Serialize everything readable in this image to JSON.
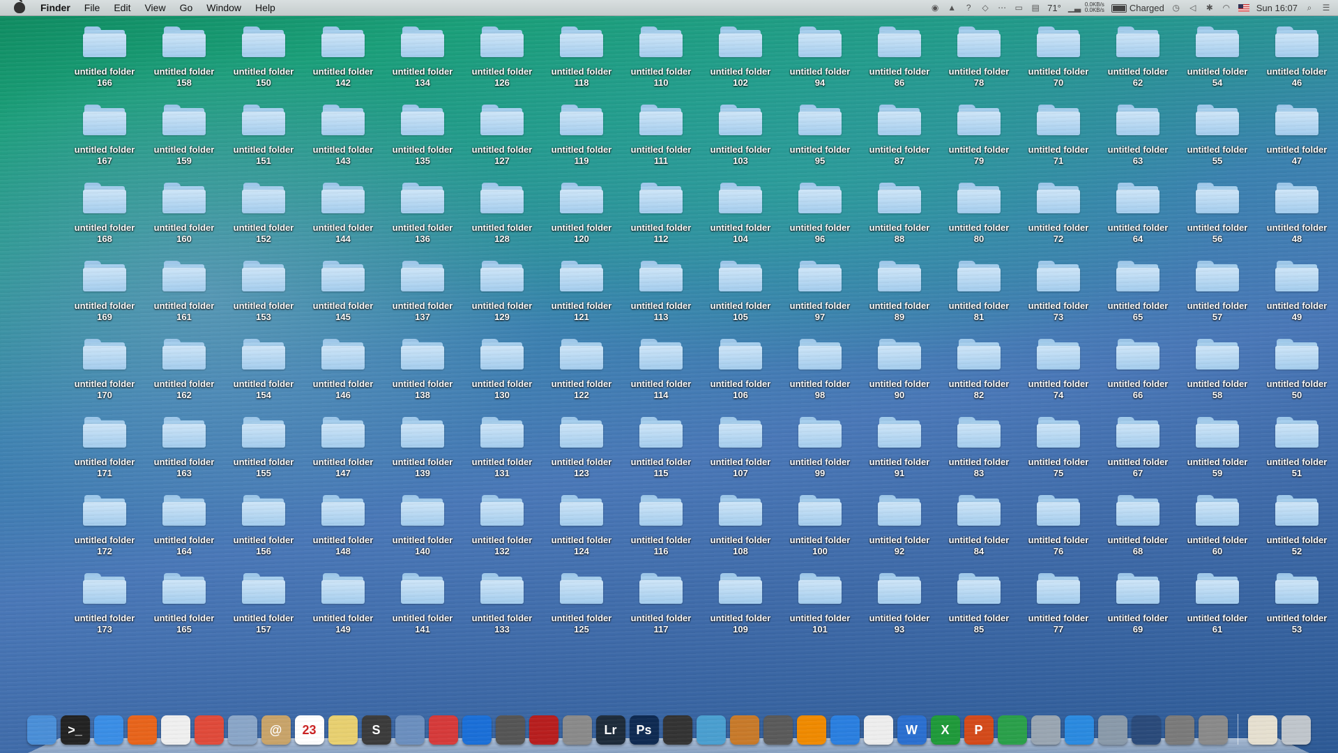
{
  "menubar": {
    "app_name": "Finder",
    "items": [
      "File",
      "Edit",
      "View",
      "Go",
      "Window",
      "Help"
    ],
    "temperature": "71°",
    "network_up": "0.0KB/s",
    "network_down": "0.0KB/s",
    "battery_status": "Charged",
    "clock": "Sun 16:07"
  },
  "folders_label": "untitled folder",
  "folder_numbers": [
    166,
    158,
    150,
    142,
    134,
    126,
    118,
    110,
    102,
    94,
    86,
    78,
    70,
    62,
    54,
    46,
    167,
    159,
    151,
    143,
    135,
    127,
    119,
    111,
    103,
    95,
    87,
    79,
    71,
    63,
    55,
    47,
    168,
    160,
    152,
    144,
    136,
    128,
    120,
    112,
    104,
    96,
    88,
    80,
    72,
    64,
    56,
    48,
    169,
    161,
    153,
    145,
    137,
    129,
    121,
    113,
    105,
    97,
    89,
    81,
    73,
    65,
    57,
    49,
    170,
    162,
    154,
    146,
    138,
    130,
    122,
    114,
    106,
    98,
    90,
    82,
    74,
    66,
    58,
    50,
    171,
    163,
    155,
    147,
    139,
    131,
    123,
    115,
    107,
    99,
    91,
    83,
    75,
    67,
    59,
    51,
    172,
    164,
    156,
    148,
    140,
    132,
    124,
    116,
    108,
    100,
    92,
    84,
    76,
    68,
    60,
    52,
    173,
    165,
    157,
    149,
    141,
    133,
    125,
    117,
    109,
    101,
    93,
    85,
    77,
    69,
    61,
    53
  ],
  "dock": {
    "items": [
      {
        "name": "finder",
        "label": "",
        "color": "#4a8fd8"
      },
      {
        "name": "terminal",
        "label": ">_",
        "color": "#222222"
      },
      {
        "name": "safari",
        "label": "",
        "color": "#3a8ee6"
      },
      {
        "name": "firefox",
        "label": "",
        "color": "#e8641b"
      },
      {
        "name": "launchpad",
        "label": "",
        "color": "#f0f0f0"
      },
      {
        "name": "chrome",
        "label": "",
        "color": "#e04a3a"
      },
      {
        "name": "preview",
        "label": "",
        "color": "#8aa6c8"
      },
      {
        "name": "contacts",
        "label": "@",
        "color": "#c9a46a"
      },
      {
        "name": "calendar",
        "label": "23",
        "color": "#ffffff"
      },
      {
        "name": "photo-viewer",
        "label": "",
        "color": "#e8d070"
      },
      {
        "name": "sublime-text",
        "label": "S",
        "color": "#3b3b3b"
      },
      {
        "name": "archive-utility",
        "label": "",
        "color": "#6b8fbf"
      },
      {
        "name": "parallels",
        "label": "",
        "color": "#d63a3a"
      },
      {
        "name": "teamviewer",
        "label": "",
        "color": "#1a6fd8"
      },
      {
        "name": "facetime",
        "label": "",
        "color": "#555555"
      },
      {
        "name": "photo-booth",
        "label": "",
        "color": "#b81e1e"
      },
      {
        "name": "automator",
        "label": "",
        "color": "#8a8a8a"
      },
      {
        "name": "lightroom",
        "label": "Lr",
        "color": "#1d2b3a"
      },
      {
        "name": "photoshop",
        "label": "Ps",
        "color": "#0e2a52"
      },
      {
        "name": "final-cut-pro",
        "label": "",
        "color": "#333333"
      },
      {
        "name": "iphoto",
        "label": "",
        "color": "#4a9fd0"
      },
      {
        "name": "garageband",
        "label": "",
        "color": "#c87a2a"
      },
      {
        "name": "disk-utility",
        "label": "",
        "color": "#5a5a5a"
      },
      {
        "name": "vlc",
        "label": "",
        "color": "#f08a00"
      },
      {
        "name": "itunes",
        "label": "",
        "color": "#2a7fe0"
      },
      {
        "name": "textedit",
        "label": "",
        "color": "#eeeeee"
      },
      {
        "name": "word",
        "label": "W",
        "color": "#2a6fd0"
      },
      {
        "name": "excel",
        "label": "X",
        "color": "#1f9a3a"
      },
      {
        "name": "powerpoint",
        "label": "P",
        "color": "#d44a1a"
      },
      {
        "name": "network-globe",
        "label": "",
        "color": "#2aa04a"
      },
      {
        "name": "directory-utility",
        "label": "",
        "color": "#9aa6b2"
      },
      {
        "name": "app-store",
        "label": "",
        "color": "#2a8ae0"
      },
      {
        "name": "xcode-instruments",
        "label": "",
        "color": "#8a9aaa"
      },
      {
        "name": "activity-monitor",
        "label": "",
        "color": "#2a4a7a"
      },
      {
        "name": "system-information",
        "label": "",
        "color": "#7a7a7a"
      },
      {
        "name": "system-preferences",
        "label": "",
        "color": "#8a8a8a"
      }
    ],
    "after_separator": [
      {
        "name": "downloads-stack",
        "label": "",
        "color": "#e6e0d0"
      },
      {
        "name": "trash",
        "label": "",
        "color": "#c0c6cc"
      }
    ]
  }
}
